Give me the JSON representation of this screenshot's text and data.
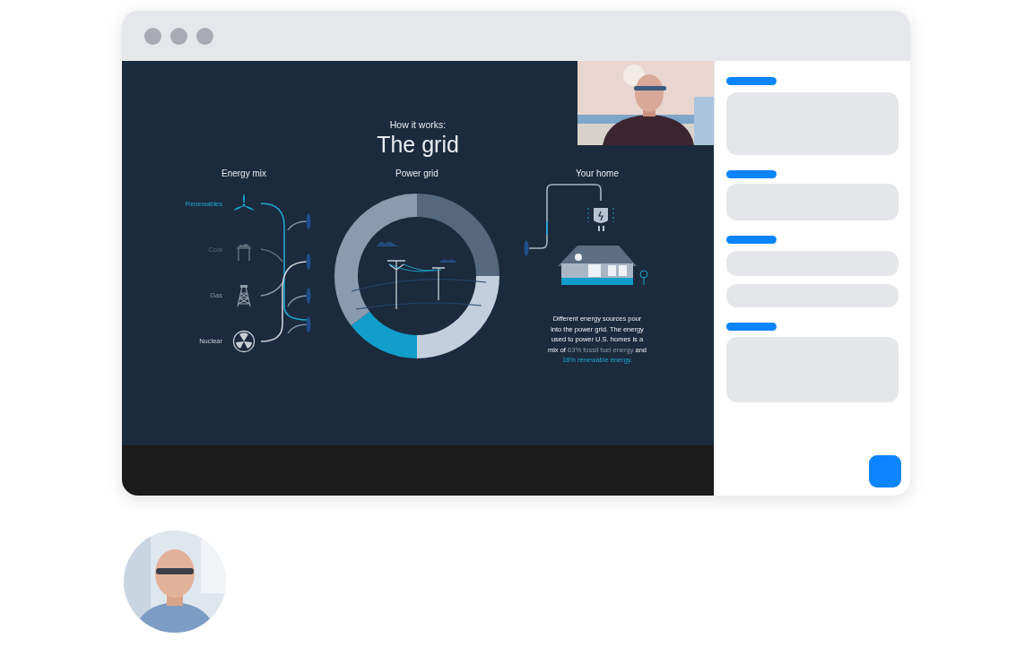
{
  "slide": {
    "kicker": "How it works:",
    "title": "The grid",
    "energy_mix": {
      "heading": "Energy mix",
      "sources": [
        {
          "label": "Renewables",
          "kind": "turbine",
          "color": "#1ea7cf"
        },
        {
          "label": "Coal",
          "kind": "factory",
          "color": "#5e6b7a"
        },
        {
          "label": "Gas",
          "kind": "derrick",
          "color": "#8f9aa7"
        },
        {
          "label": "Nuclear",
          "kind": "radiation",
          "color": "#c9cfd6"
        }
      ]
    },
    "power_grid": {
      "heading": "Power grid"
    },
    "your_home": {
      "heading": "Your home",
      "description": [
        {
          "text": "Different energy sources pour into the power grid. The energy used to power U.S.  homes is a mix of ",
          "kind": "plain"
        },
        {
          "text": "63% fossil fuel energy",
          "kind": "fossil"
        },
        {
          "text": " and ",
          "kind": "plain"
        },
        {
          "text": "18% renewable energy.",
          "kind": "renewable"
        }
      ]
    }
  }
}
